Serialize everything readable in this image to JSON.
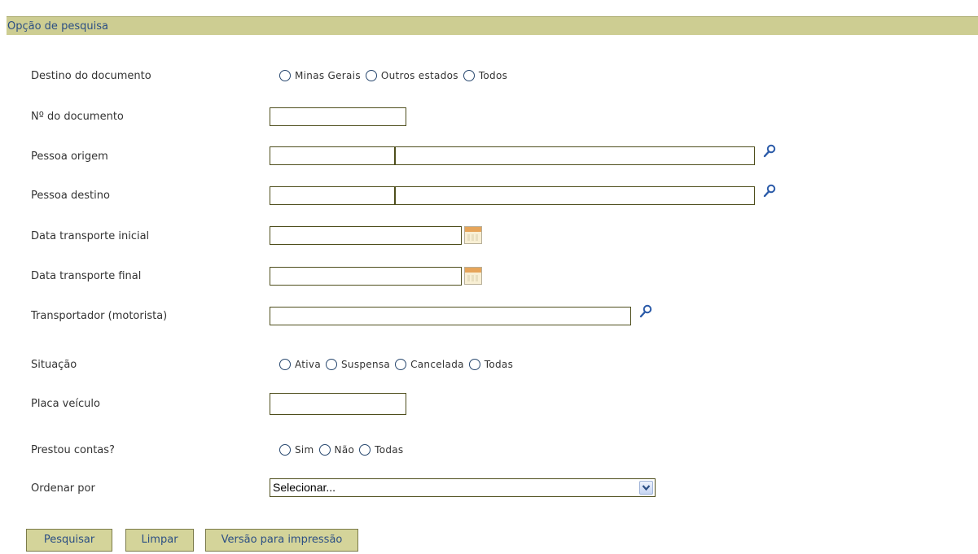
{
  "header": {
    "title": "Opção de pesquisa"
  },
  "fields": {
    "destino": {
      "label": "Destino do documento",
      "options": [
        "Minas Gerais",
        "Outros estados",
        "Todos"
      ]
    },
    "numero": {
      "label": "Nº do documento",
      "value": ""
    },
    "pessoa_origem": {
      "label": "Pessoa origem",
      "code": "",
      "name": ""
    },
    "pessoa_destino": {
      "label": "Pessoa destino",
      "code": "",
      "name": ""
    },
    "data_inicial": {
      "label": "Data transporte inicial",
      "value": ""
    },
    "data_final": {
      "label": "Data transporte final",
      "value": ""
    },
    "transportador": {
      "label": "Transportador (motorista)",
      "value": ""
    },
    "situacao": {
      "label": "Situação",
      "options": [
        "Ativa",
        "Suspensa",
        "Cancelada",
        "Todas"
      ]
    },
    "placa": {
      "label": "Placa veículo",
      "value": ""
    },
    "prestou": {
      "label": "Prestou contas?",
      "options": [
        "Sim",
        "Não",
        "Todas"
      ]
    },
    "ordenar": {
      "label": "Ordenar por",
      "selected": "Selecionar..."
    }
  },
  "buttons": {
    "pesquisar": "Pesquisar",
    "limpar": "Limpar",
    "impressao": "Versão para impressão"
  },
  "icons": {
    "search": "magnifier-icon",
    "calendar": "calendar-icon",
    "dropdown": "chevron-down-icon"
  },
  "colors": {
    "header_bg": "#cdcd92",
    "header_text": "#2c4f84",
    "input_border": "#4e4e1c",
    "button_bg": "#d4d49a",
    "radio": "#27476e"
  }
}
